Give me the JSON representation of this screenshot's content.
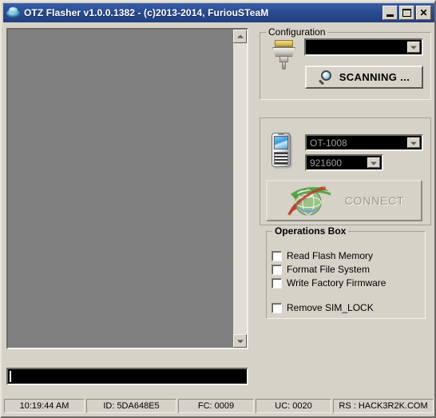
{
  "window": {
    "title": "OTZ Flasher v1.0.0.1382 - (c)2013-2014, FuriouSTeaM",
    "icon": "app-disc-icon",
    "minimize_label": "",
    "maximize_label": "",
    "close_label": "✕"
  },
  "log_panel": {
    "content": "",
    "scroll_up_label": "",
    "scroll_down_label": ""
  },
  "progress": {
    "value": ""
  },
  "configuration": {
    "title": "Configuration",
    "port_value": "",
    "port_placeholder": "",
    "scan_button_label": "SCANNING ...",
    "connector_icon": "serial-connector-icon",
    "magnifier_icon": "magnifier-icon"
  },
  "device": {
    "phone_icon": "mobile-phone-icon",
    "model_value": "OT-1008",
    "baud_value": "921600",
    "connect_button_label": "CONNECT",
    "connect_icon": "globe-network-icon"
  },
  "operations": {
    "title": "Operations Box",
    "items": [
      {
        "label": "Read Flash Memory",
        "checked": false
      },
      {
        "label": "Format File System",
        "checked": false
      },
      {
        "label": "Write Factory Firmware",
        "checked": false
      },
      {
        "label": "Remove SIM_LOCK",
        "checked": false
      }
    ]
  },
  "statusbar": {
    "time": "10:19:44 AM",
    "id": "ID: 5DA648E5",
    "fc": "FC: 0009",
    "uc": "UC: 0020",
    "rs": "RS : HACK3R2K.COM"
  },
  "colors": {
    "titlebar": "#2b4c92",
    "face": "#d6d2c8",
    "log_background": "#808080",
    "combo_background": "#000000",
    "combo_text": "#9e9e9e"
  }
}
